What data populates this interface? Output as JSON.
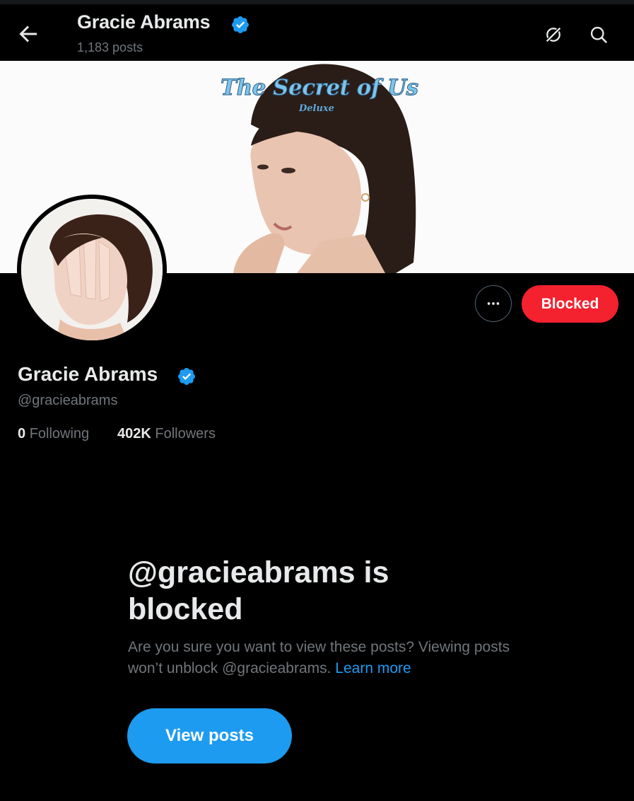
{
  "header": {
    "name": "Gracie Abrams",
    "post_count": "1,183 posts"
  },
  "banner": {
    "title": "The Secret of Us",
    "subtitle": "Deluxe"
  },
  "profile": {
    "name": "Gracie Abrams",
    "handle": "@gracieabrams",
    "following_count": "0",
    "following_label": "Following",
    "followers_count": "402K",
    "followers_label": "Followers"
  },
  "actions": {
    "blocked_label": "Blocked"
  },
  "blocked_notice": {
    "title": "@gracieabrams is blocked",
    "text": "Are you sure you want to view these posts? Viewing posts won’t unblock @gracieabrams.",
    "learn_more": "Learn more",
    "button": "View posts"
  },
  "colors": {
    "background": "#000000",
    "verified": "#1d9bf0",
    "blocked_button": "#f4212e",
    "primary_button": "#1d9bf0",
    "secondary_text": "#71767b"
  },
  "icons": [
    "back-arrow-icon",
    "verified-badge-icon",
    "grok-icon",
    "search-icon",
    "more-icon"
  ]
}
